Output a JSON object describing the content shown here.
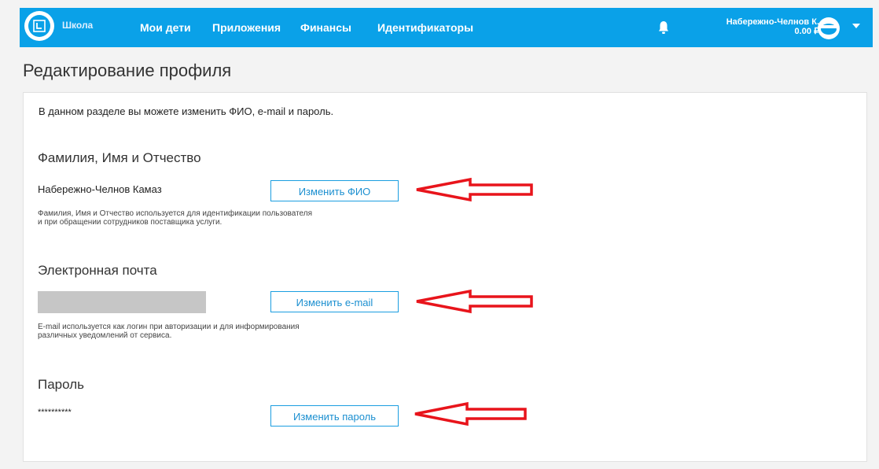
{
  "header": {
    "brand": "Школа",
    "nav": [
      {
        "label": "Мои дети"
      },
      {
        "label": "Приложения"
      },
      {
        "label": "Финансы"
      },
      {
        "label": "Идентификаторы"
      }
    ],
    "user_name": "Набережно-Челнов К.",
    "balance": "0.00 ₽"
  },
  "page": {
    "title": "Редактирование профиля",
    "intro": "В данном разделе вы можете изменить ФИО, e-mail и пароль."
  },
  "sections": {
    "name": {
      "title": "Фамилия, Имя и Отчество",
      "value": "Набережно-Челнов Камаз",
      "button": "Изменить ФИО",
      "help_line1": "Фамилия, Имя и Отчество используется для идентификации пользователя",
      "help_line2": "и при обращении сотрудников поставщика услуги."
    },
    "email": {
      "title": "Электронная почта",
      "button": "Изменить e-mail",
      "help_line1": "E-mail используется как логин при авторизации и для информирования",
      "help_line2": "различных уведомлений от сервиса."
    },
    "password": {
      "title": "Пароль",
      "value": "**********",
      "button": "Изменить пароль"
    }
  },
  "colors": {
    "header_bg": "#0aa1e8",
    "button_border": "#1b9ee0",
    "annotation_arrow": "#e8141b"
  }
}
